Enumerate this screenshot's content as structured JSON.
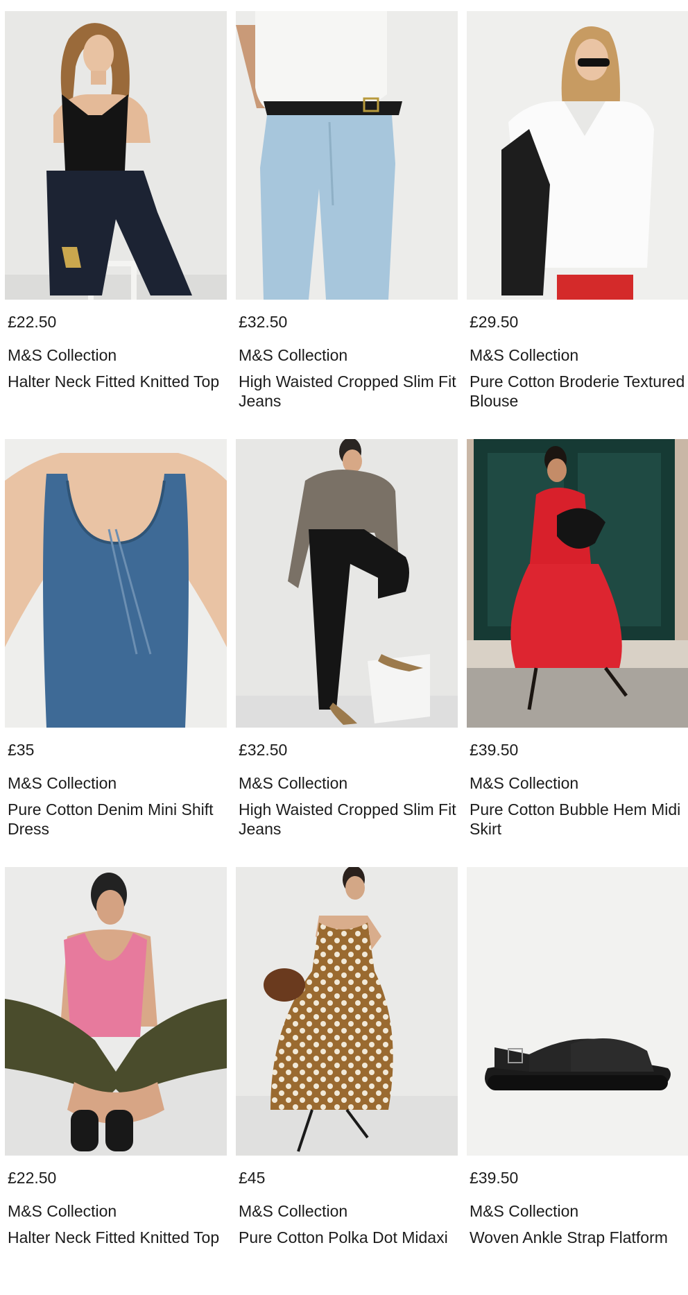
{
  "products": [
    {
      "price": "£22.50",
      "brand": "M&S Collection",
      "title": "Halter Neck Fitted Knitted Top",
      "image_desc": "woman-black-halter-top"
    },
    {
      "price": "£32.50",
      "brand": "M&S Collection",
      "title": "High Waisted Cropped Slim Fit Jeans",
      "image_desc": "light-blue-jeans"
    },
    {
      "price": "£29.50",
      "brand": "M&S Collection",
      "title": "Pure Cotton Broderie Textured Blouse",
      "image_desc": "white-broderie-blouse"
    },
    {
      "price": "£35",
      "brand": "M&S Collection",
      "title": "Pure Cotton Denim Mini Shift Dress",
      "image_desc": "denim-shift-dress-back"
    },
    {
      "price": "£32.50",
      "brand": "M&S Collection",
      "title": "High Waisted Cropped Slim Fit Jeans",
      "image_desc": "black-cropped-jeans"
    },
    {
      "price": "£39.50",
      "brand": "M&S Collection",
      "title": "Pure Cotton Bubble Hem Midi Skirt",
      "image_desc": "red-bubble-hem-skirt"
    },
    {
      "price": "£22.50",
      "brand": "M&S Collection",
      "title": "Halter Neck Fitted Knitted Top",
      "image_desc": "pink-halter-top"
    },
    {
      "price": "£45",
      "brand": "M&S Collection",
      "title": "Pure Cotton Polka Dot Midaxi",
      "image_desc": "brown-polka-dot-dress"
    },
    {
      "price": "£39.50",
      "brand": "M&S Collection",
      "title": "Woven Ankle Strap Flatform",
      "image_desc": "black-woven-sandal"
    }
  ],
  "colors": {
    "text": "#1c1c1c",
    "image_bg": "#ececeb"
  }
}
